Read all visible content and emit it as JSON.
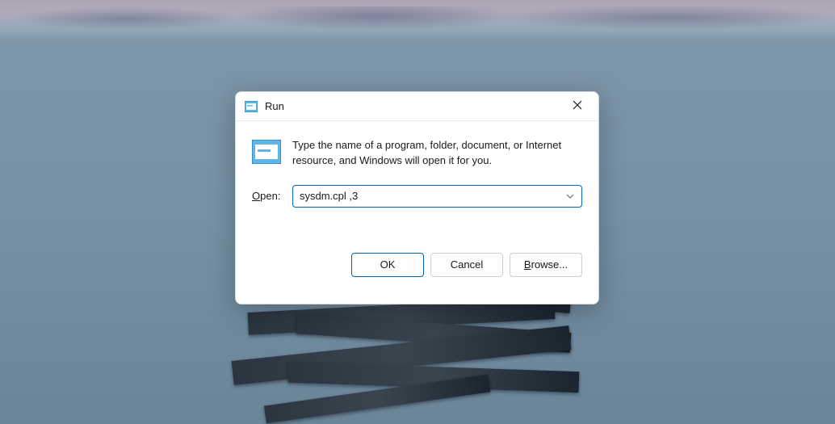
{
  "dialog": {
    "title": "Run",
    "description": "Type the name of a program, folder, document, or Internet resource, and Windows will open it for you.",
    "open_label_underlined": "O",
    "open_label_rest": "pen:",
    "input_value": "sysdm.cpl ,3",
    "buttons": {
      "ok": "OK",
      "cancel": "Cancel",
      "browse_underlined": "B",
      "browse_rest": "rowse..."
    }
  },
  "icons": {
    "run_small": "run-small-icon",
    "run_large": "run-large-icon",
    "close": "close-icon",
    "chevron_down": "chevron-down-icon"
  }
}
